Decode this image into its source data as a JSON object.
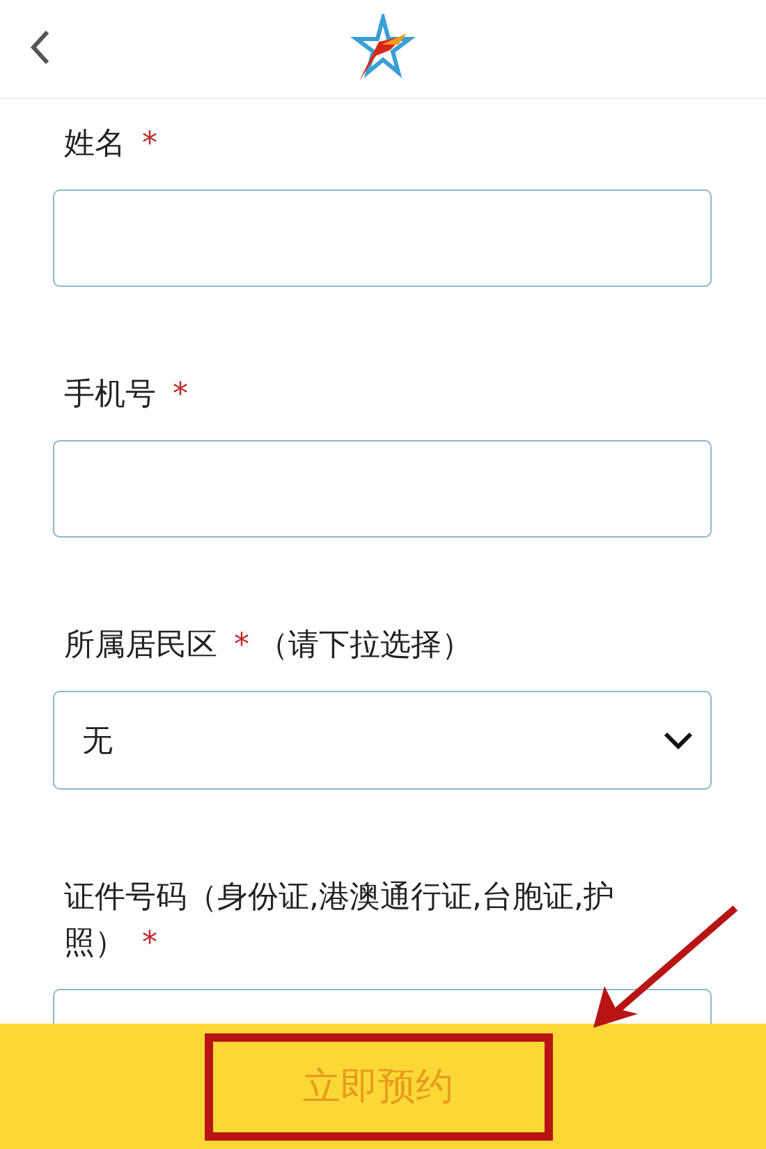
{
  "fields": [
    {
      "kind": "text",
      "label": "姓名",
      "required_mark": "*"
    },
    {
      "kind": "text",
      "label": "手机号",
      "required_mark": "*"
    },
    {
      "kind": "select",
      "label": "所属居民区",
      "required_mark": "*",
      "hint": "（请下拉选择）",
      "value": "无"
    },
    {
      "kind": "text",
      "label": "证件号码（身份证,港澳通行证,台胞证,护照）",
      "required_mark": "*"
    }
  ],
  "footer": {
    "button": "立即预约"
  }
}
